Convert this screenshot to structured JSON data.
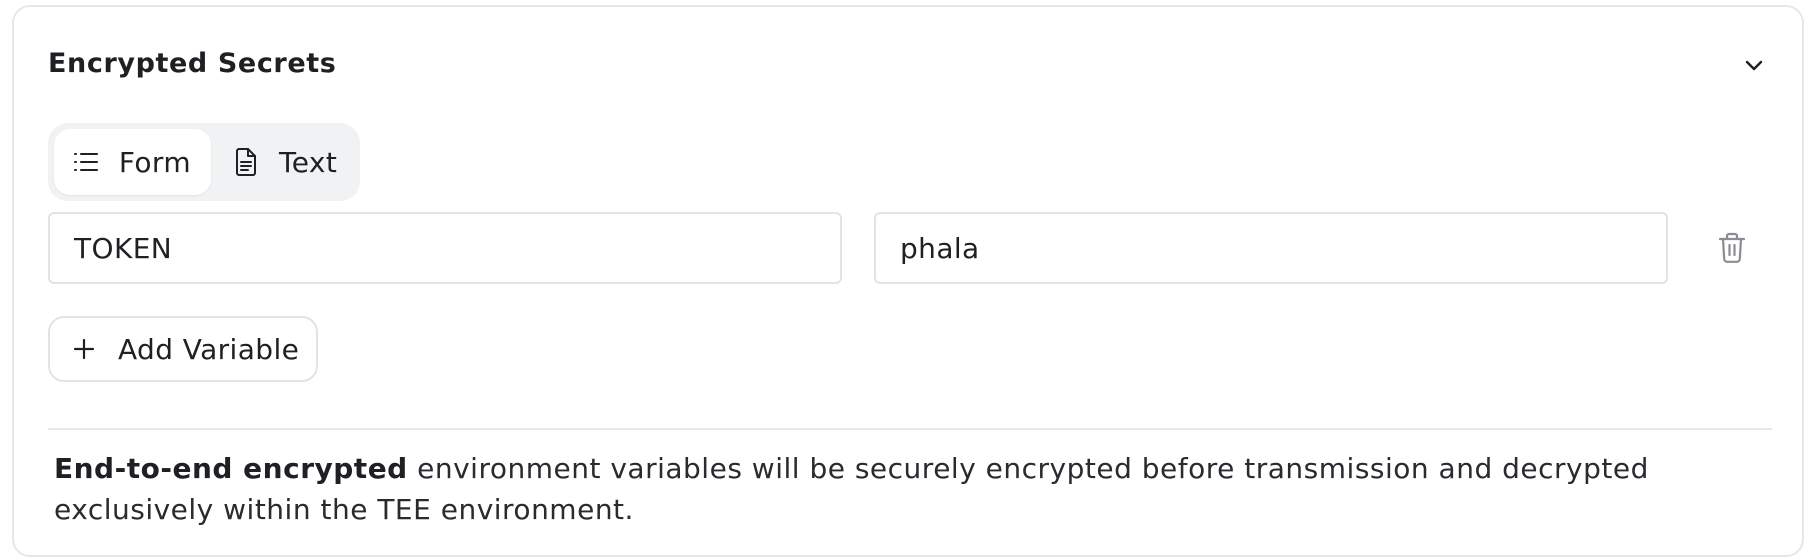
{
  "section": {
    "title": "Encrypted Secrets",
    "collapse_icon": "chevron-down-icon"
  },
  "mode_toggle": {
    "options": [
      {
        "label": "Form",
        "icon": "list-icon",
        "active": true
      },
      {
        "label": "Text",
        "icon": "document-icon",
        "active": false
      }
    ]
  },
  "variables": [
    {
      "key": "TOKEN",
      "value": "phala",
      "delete_icon": "trash-icon"
    }
  ],
  "add_button": {
    "label": "Add Variable",
    "icon": "plus-icon"
  },
  "note": {
    "bold": "End-to-end encrypted",
    "text": " environment variables will be securely encrypted before transmission and decrypted exclusively within the TEE environment."
  },
  "colors": {
    "border": "#e6e7e9",
    "toggle_bg": "#f1f2f3",
    "text": "#1f2024",
    "icon_muted": "#8a8d93"
  }
}
